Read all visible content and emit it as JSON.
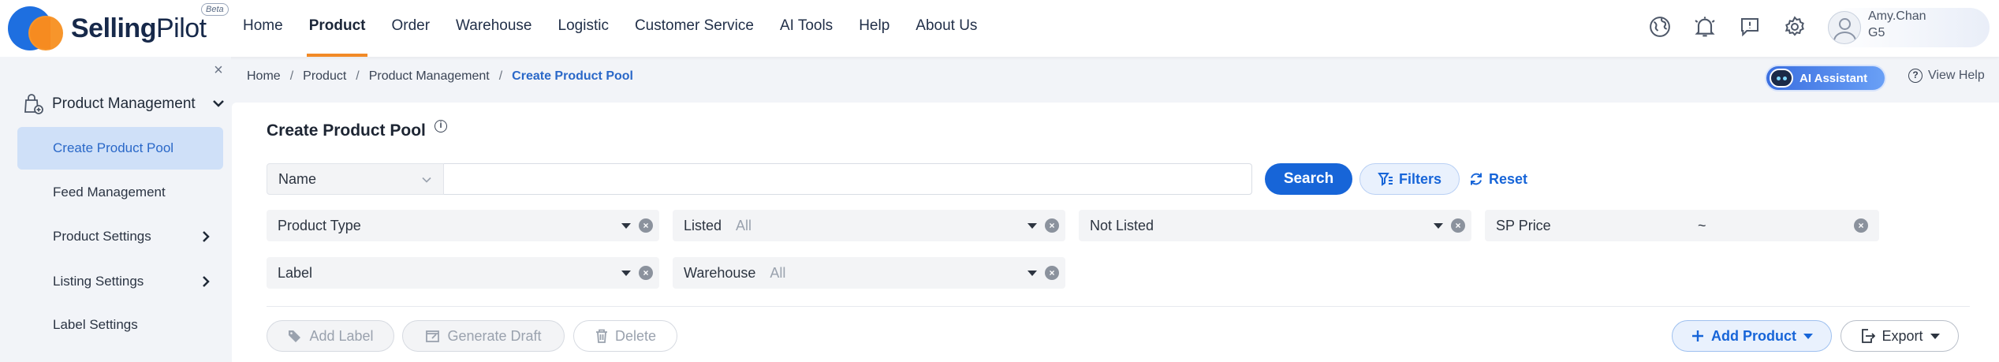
{
  "brand": {
    "name_bold": "Selling",
    "name_light": "Pilot",
    "badge": "Beta"
  },
  "nav": {
    "items": [
      {
        "label": "Home"
      },
      {
        "label": "Product",
        "active": true
      },
      {
        "label": "Order"
      },
      {
        "label": "Warehouse"
      },
      {
        "label": "Logistic"
      },
      {
        "label": "Customer Service"
      },
      {
        "label": "AI Tools"
      },
      {
        "label": "Help"
      },
      {
        "label": "About Us"
      }
    ]
  },
  "top_icons": [
    "globe-icon",
    "bell-icon",
    "message-icon",
    "gear-icon"
  ],
  "user": {
    "name": "Amy.Chan",
    "org": "G5"
  },
  "sidebar": {
    "section": "Product Management",
    "items": [
      {
        "label": "Create Product Pool",
        "active": true
      },
      {
        "label": "Feed Management"
      },
      {
        "label": "Product Settings",
        "has_children": true
      },
      {
        "label": "Listing Settings",
        "has_children": true
      },
      {
        "label": "Label Settings"
      }
    ]
  },
  "breadcrumb": {
    "items": [
      "Home",
      "Product",
      "Product Management"
    ],
    "current": "Create Product Pool"
  },
  "assistant": {
    "label": "AI Assistant"
  },
  "help": {
    "label": "View Help"
  },
  "page": {
    "title": "Create Product Pool"
  },
  "search": {
    "field": "Name",
    "value": "",
    "search_label": "Search",
    "filters_label": "Filters",
    "reset_label": "Reset"
  },
  "filters": {
    "product_type": {
      "label": "Product Type",
      "value": ""
    },
    "listed": {
      "label": "Listed",
      "value": "All"
    },
    "not_listed": {
      "label": "Not Listed",
      "value": ""
    },
    "sp_price": {
      "label": "SP Price",
      "separator": "~"
    },
    "label": {
      "label": "Label",
      "value": ""
    },
    "warehouse": {
      "label": "Warehouse",
      "value": "All"
    }
  },
  "actions": {
    "add_label": "Add Label",
    "generate_draft": "Generate Draft",
    "delete": "Delete",
    "add_product": "Add Product",
    "export": "Export"
  },
  "colors": {
    "primary": "#1765d8",
    "accent": "#f28a26",
    "active_bg": "#cfe0f8"
  }
}
